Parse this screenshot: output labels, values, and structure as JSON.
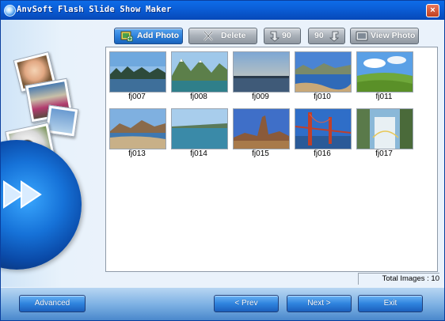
{
  "window": {
    "title": "AnvSoft Flash Slide Show Maker",
    "close_label": "×"
  },
  "toolbar": {
    "add_photo": "Add Photo",
    "delete": "Delete",
    "rotate_left": "90",
    "rotate_right": "90",
    "view_photo": "View Photo"
  },
  "photos": [
    {
      "name": "fj007",
      "icon": "lake-photo"
    },
    {
      "name": "fj008",
      "icon": "mountain-lake-photo"
    },
    {
      "name": "fj009",
      "icon": "dusk-lake-photo"
    },
    {
      "name": "fj010",
      "icon": "lake-shore-photo"
    },
    {
      "name": "fj011",
      "icon": "meadow-photo"
    },
    {
      "name": "fj013",
      "icon": "beach-photo"
    },
    {
      "name": "fj014",
      "icon": "river-photo"
    },
    {
      "name": "fj015",
      "icon": "rock-formation-photo"
    },
    {
      "name": "fj016",
      "icon": "bridge-photo"
    },
    {
      "name": "fj017",
      "icon": "waterfall-photo"
    }
  ],
  "status": {
    "total_images": "Total Images : 10"
  },
  "bottom": {
    "advanced": "Advanced",
    "prev": "< Prev",
    "next": "Next >",
    "exit": "Exit"
  },
  "colors": {
    "title_bar": "#0b5fd8",
    "button_blue": "#2f84de",
    "toolbar_gray": "#a9b0b8"
  }
}
